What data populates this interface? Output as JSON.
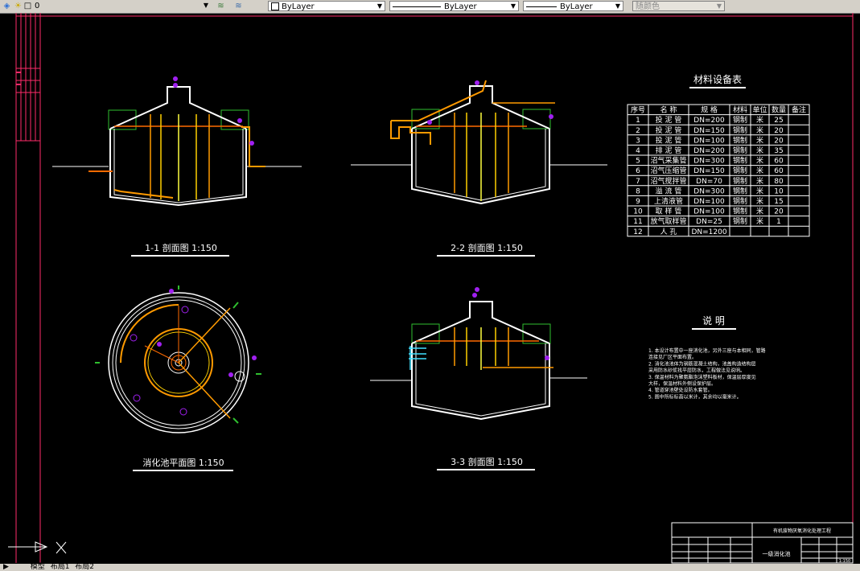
{
  "toolbar": {
    "layer_value": "0",
    "color_value": "ByLayer",
    "linetype_value": "ByLayer",
    "lineweight_value": "ByLayer",
    "plotstyle_value": "随颜色"
  },
  "drawing": {
    "section_1_title": "1-1 剖面图 1:150",
    "section_2_title": "2-2 剖面图 1:150",
    "section_3_title": "3-3 剖面图 1:150",
    "plan_title": "消化池平面图 1:150",
    "table_title": "材料设备表",
    "notes_title": "说    明",
    "table_headers": [
      "序号",
      "名    称",
      "规    格",
      "材料",
      "单位",
      "数量",
      "备注"
    ],
    "table_rows": [
      [
        "1",
        "投 泥 管",
        "DN=200",
        "钢制",
        "米",
        "25",
        ""
      ],
      [
        "2",
        "投 泥 管",
        "DN=150",
        "钢制",
        "米",
        "20",
        ""
      ],
      [
        "3",
        "投 泥 管",
        "DN=100",
        "钢制",
        "米",
        "20",
        ""
      ],
      [
        "4",
        "排 泥 管",
        "DN=200",
        "钢制",
        "米",
        "35",
        ""
      ],
      [
        "5",
        "沼气采集管",
        "DN=300",
        "钢制",
        "米",
        "60",
        ""
      ],
      [
        "6",
        "沼气压缩管",
        "DN=150",
        "钢制",
        "米",
        "60",
        ""
      ],
      [
        "7",
        "沼气搅拌管",
        "DN=70",
        "钢制",
        "米",
        "80",
        ""
      ],
      [
        "8",
        "溢 流 管",
        "DN=300",
        "钢制",
        "米",
        "10",
        ""
      ],
      [
        "9",
        "上清液管",
        "DN=100",
        "钢制",
        "米",
        "15",
        ""
      ],
      [
        "10",
        "取 样 管",
        "DN=100",
        "钢制",
        "米",
        "20",
        ""
      ],
      [
        "11",
        "放气取样管",
        "DN=25",
        "钢制",
        "米",
        "1",
        ""
      ],
      [
        "12",
        "人    孔",
        "DN=1200",
        "",
        "",
        "",
        ""
      ]
    ],
    "notes": [
      "1. 本设计布置中一座消化池，另外三座与本相同，管路",
      "   连接见厂区平面布置。",
      "2. 消化池池体为钢筋混凝土结构，池盖构造结构层",
      "   采用防水砂浆找平层防水，工程做法见说明。",
      "3. 保温材料为聚氨酯泡沫塑料板材，保温层厚度见",
      "   大样，保温材料外侧设保护层。",
      "4. 管道穿池壁处设防水套管。",
      "5. 图中所标标高以米计，其余均以毫米计。"
    ],
    "title_block": {
      "project": "有机废物厌氧消化处理工程",
      "drawing_name": "一级消化池",
      "scale": "1:150"
    }
  },
  "tabs": {
    "model": "模型",
    "layout1": "布局1",
    "layout2": "布局2"
  }
}
